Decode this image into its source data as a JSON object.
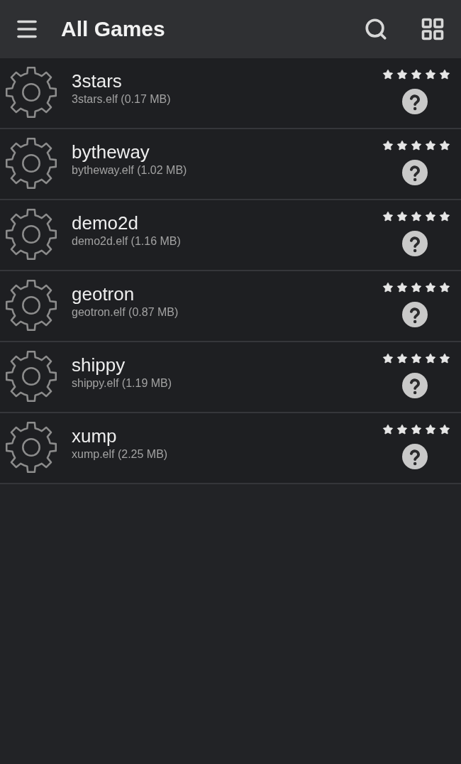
{
  "app_bar": {
    "title": "All Games"
  },
  "games": [
    {
      "name": "3stars",
      "file": "3stars.elf (0.17 MB)",
      "stars": 5
    },
    {
      "name": "bytheway",
      "file": "bytheway.elf (1.02 MB)",
      "stars": 5
    },
    {
      "name": "demo2d",
      "file": "demo2d.elf (1.16 MB)",
      "stars": 5
    },
    {
      "name": "geotron",
      "file": "geotron.elf (0.87 MB)",
      "stars": 5
    },
    {
      "name": "shippy",
      "file": "shippy.elf (1.19 MB)",
      "stars": 5
    },
    {
      "name": "xump",
      "file": "xump.elf (2.25 MB)",
      "stars": 5
    }
  ]
}
